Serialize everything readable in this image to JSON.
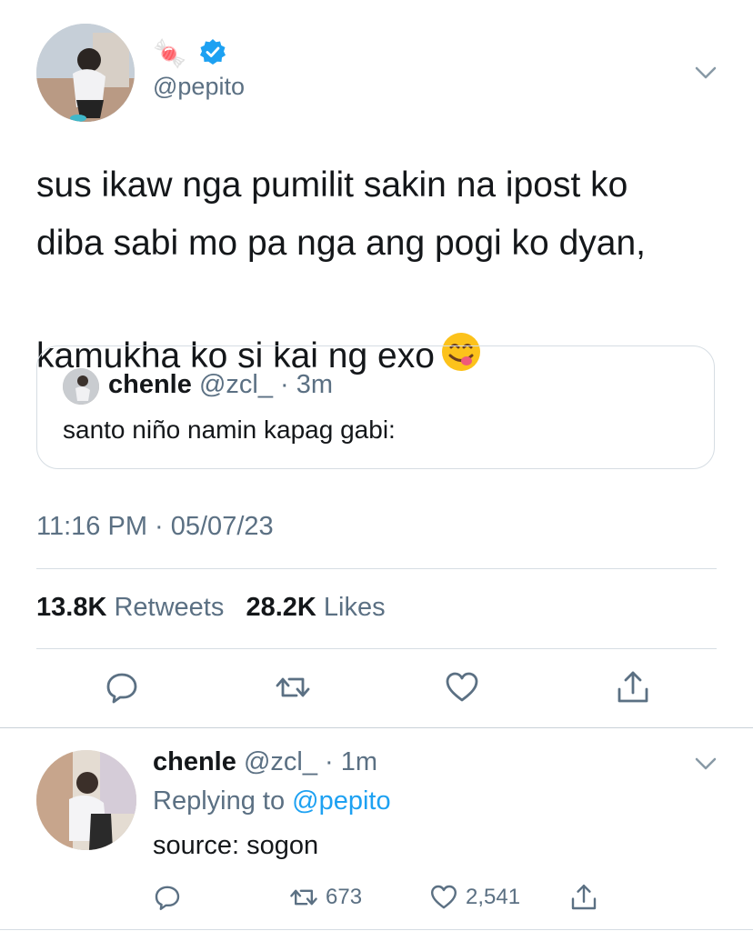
{
  "main_tweet": {
    "display_name_emoji": "🍬",
    "verified": true,
    "handle": "@pepito",
    "text": "sus ikaw nga pumilit sakin na ipost ko\ndiba sabi mo pa nga ang pogi ko dyan,\nkamukha ko si kai ng exo",
    "emoji": "😋",
    "timestamp": "11:16 PM · 05/07/23",
    "retweets_count": "13.8K",
    "retweets_label": "Retweets",
    "likes_count": "28.2K",
    "likes_label": "Likes"
  },
  "quoted_tweet": {
    "name": "chenle",
    "meta": "@zcl_ · 3m",
    "text": "santo niño namin kapag gabi:"
  },
  "reply": {
    "name": "chenle",
    "meta": "@zcl_ · 1m",
    "replying_prefix": "Replying to",
    "replying_to": "@pepito",
    "text": "source: sogon",
    "retweet_count": "673",
    "like_count": "2,541"
  },
  "colors": {
    "text": "#14171a",
    "muted": "#5b7083",
    "accent": "#1da1f2",
    "border": "#d6dde3"
  }
}
